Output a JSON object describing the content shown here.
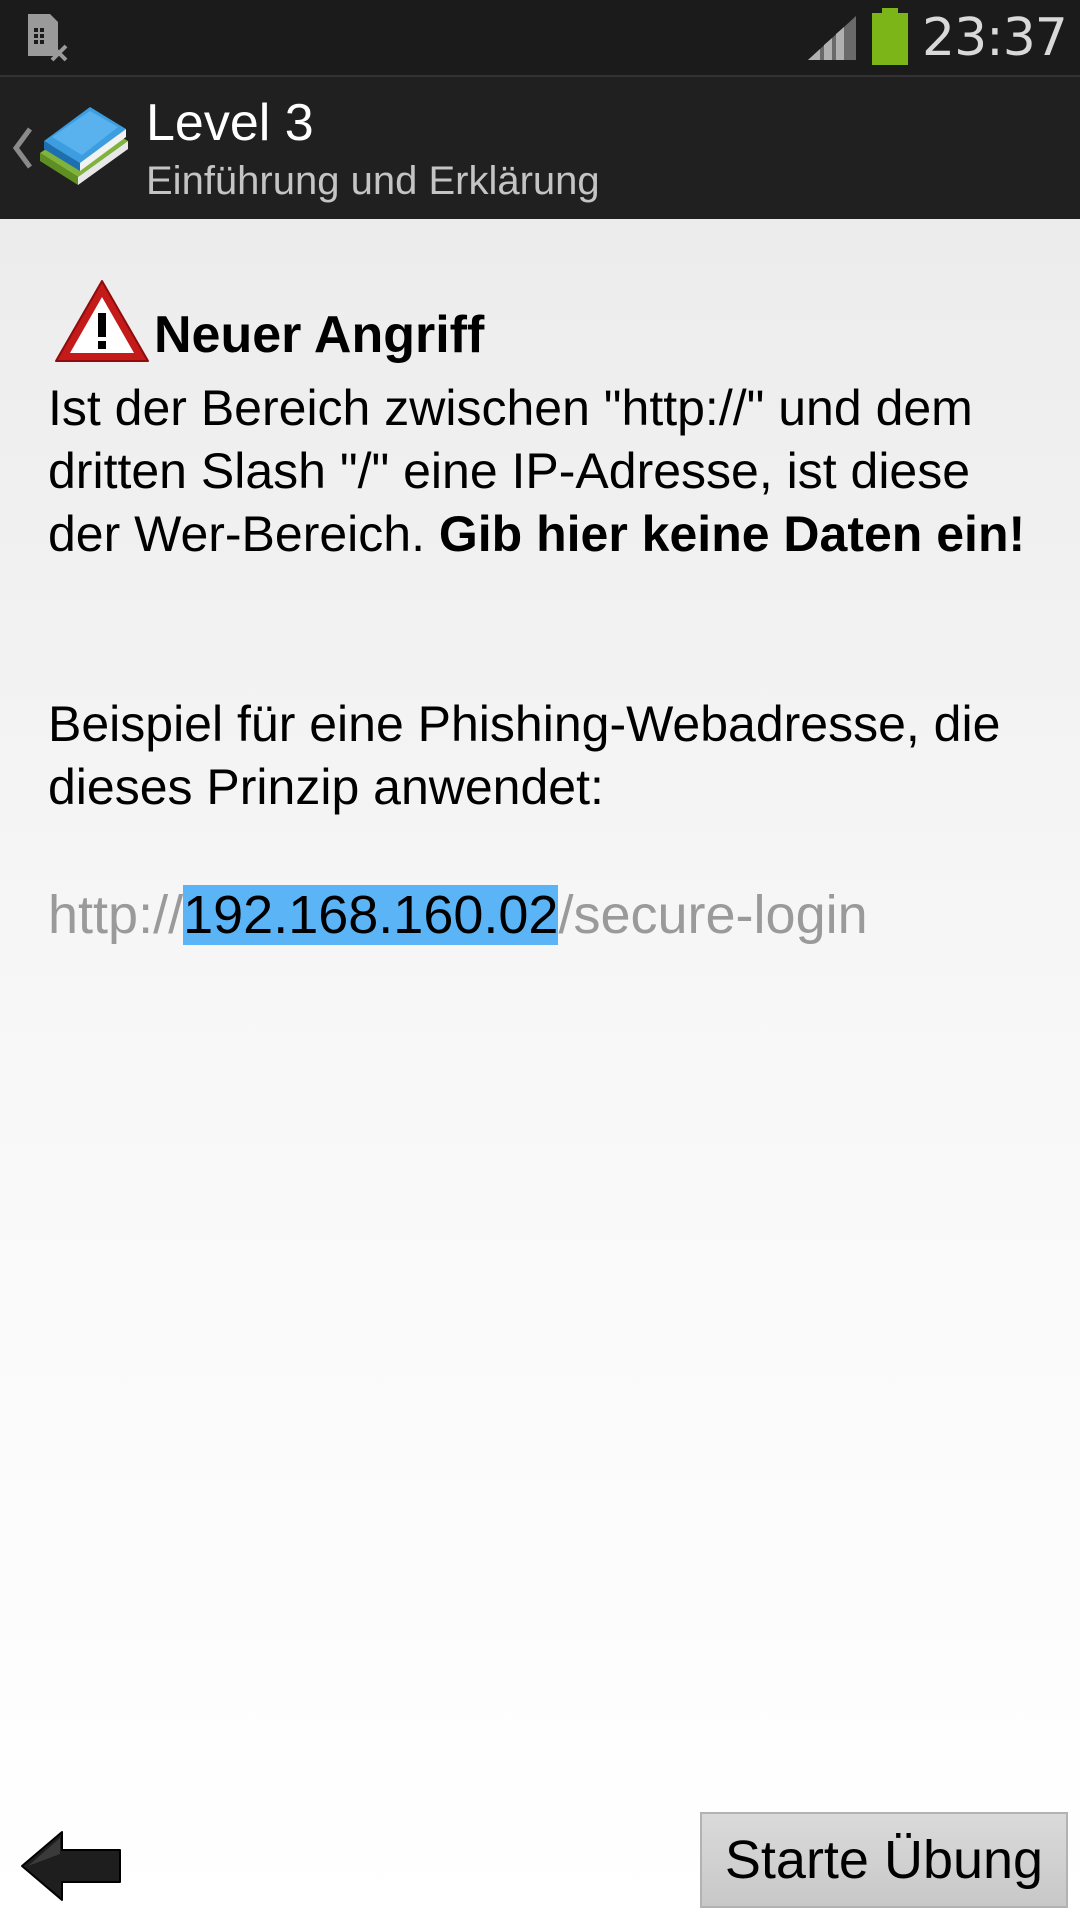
{
  "status_bar": {
    "time": "23:37",
    "icons": [
      "sim-card-error-icon",
      "signal-icon",
      "battery-icon"
    ],
    "battery_color": "#7cb518"
  },
  "action_bar": {
    "title": "Level 3",
    "subtitle": "Einführung und Erklärung",
    "icons": [
      "up-chevron-icon",
      "books-app-icon"
    ]
  },
  "content": {
    "alert_icon": "warning-icon",
    "alert_title": "Neuer Angriff",
    "paragraph1": "Ist der Bereich zwischen \"http://\" und dem dritten Slash \"/\" eine IP-Adresse, ist diese der Wer-Bereich. ",
    "paragraph1_bold": "Gib hier keine Daten ein!",
    "paragraph2": "Beispiel für eine Phishing-Webadresse, die dieses Prinzip anwendet:",
    "url": {
      "prefix": "http://",
      "highlight": "192.168.160.02",
      "suffix": "/secure-login",
      "highlight_color": "#5ab4f6"
    }
  },
  "footer": {
    "back_icon": "back-arrow-icon",
    "start_button_label": "Starte Übung"
  }
}
